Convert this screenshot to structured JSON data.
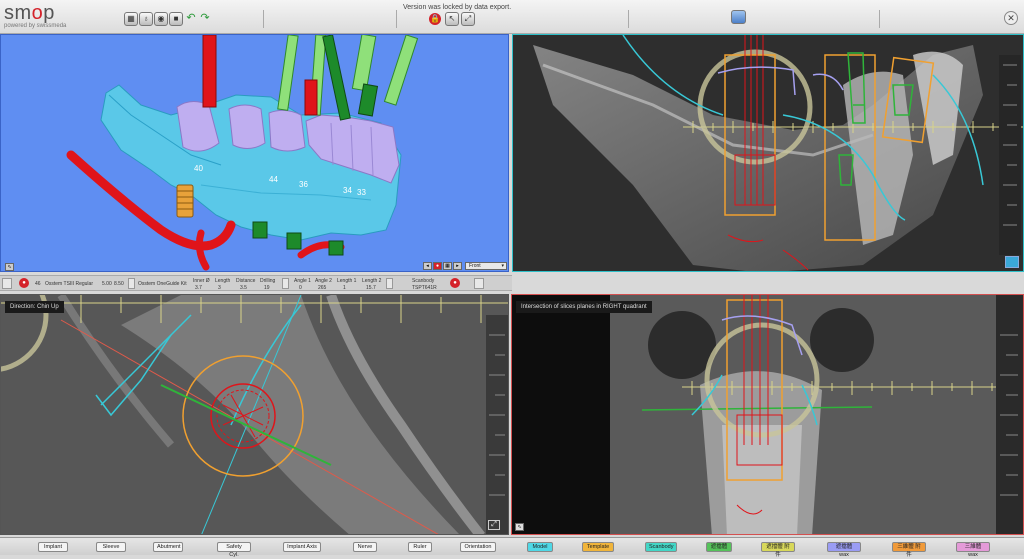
{
  "app": {
    "logo": "smop",
    "powered_by": "powered by swissmeda"
  },
  "toolbar": {
    "lock_message": "Version was locked by data export.",
    "icons": [
      "save-icon",
      "light-bulb-icon",
      "eye-icon",
      "camera-icon",
      "undo-arrow-icon",
      "redo-arrow-icon"
    ]
  },
  "view3d": {
    "labels": [
      "40",
      "44",
      "36",
      "34",
      "33"
    ],
    "view_select": "Front"
  },
  "status": {
    "implant_no": "46",
    "implant_name": "Osstem TSIII Regular",
    "dia": "5.00",
    "len": "8.50",
    "guide_kit": "Osstem OneGuide Kit",
    "inner_d_label": "Inner Ø",
    "inner_d_value": "3.7",
    "length_label": "Length",
    "length_value": "3",
    "distance_label": "Distance",
    "distance_value": "3.5",
    "drilling_label": "Drilling",
    "drilling_value": "19",
    "angle1_label": "Angle 1",
    "angle1_value": "0",
    "angle2_label": "Angle 2",
    "angle2_value": "265",
    "length1_label": "Length 1",
    "length1_value": "1",
    "length2_label": "Length 2",
    "length2_value": "15.7",
    "scanbody_label": "Scanbody",
    "scanbody_value": "TSPT641R"
  },
  "axial": {
    "label": "Direction: Chin Up"
  },
  "coronal": {
    "label": "Intersection of slices planes in RIGHT quadrant"
  },
  "bottom_buttons": [
    {
      "label": "Implant",
      "color": "#f4f4f4"
    },
    {
      "label": "Sleeve",
      "color": "#f4f4f4"
    },
    {
      "label": "Abutment",
      "color": "#f4f4f4"
    },
    {
      "label": "Safety Cyl.",
      "color": "#f4f4f4"
    },
    {
      "label": "Implant Axis",
      "color": "#f4f4f4"
    },
    {
      "label": "Nerve",
      "color": "#f4f4f4"
    },
    {
      "label": "Ruler",
      "color": "#f4f4f4"
    },
    {
      "label": "Orientation",
      "color": "#f4f4f4"
    },
    {
      "label": "Model",
      "color": "#4fd8e6"
    },
    {
      "label": "Template",
      "color": "#f0b43a"
    },
    {
      "label": "Scanbody",
      "color": "#42d6c6"
    },
    {
      "label": "遮擋體",
      "color": "#55c25a"
    },
    {
      "label": "遮擋體 附件",
      "color": "#d8d85a"
    },
    {
      "label": "遮擋體wax",
      "color": "#9a9cf4"
    },
    {
      "label": "三維體 附件",
      "color": "#f09a3a"
    },
    {
      "label": "三維體wax",
      "color": "#e49ad8"
    }
  ]
}
